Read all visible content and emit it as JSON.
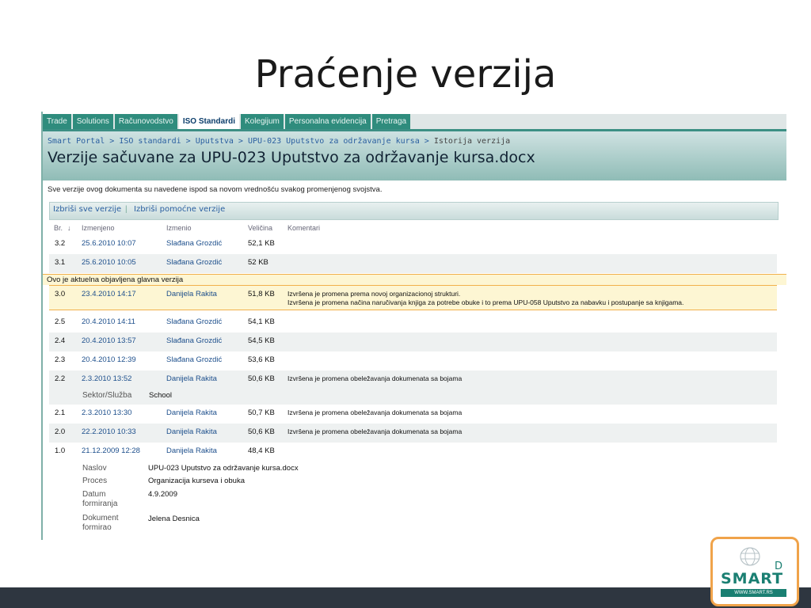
{
  "slide_title": "Praćenje verzija",
  "nav_tabs": [
    {
      "label": "Trade",
      "active": false
    },
    {
      "label": "Solutions",
      "active": false
    },
    {
      "label": "Računovodstvo",
      "active": false
    },
    {
      "label": "ISO Standardi",
      "active": true
    },
    {
      "label": "Kolegijum",
      "active": false
    },
    {
      "label": "Personalna evidencija",
      "active": false
    },
    {
      "label": "Pretraga",
      "active": false
    }
  ],
  "breadcrumb": {
    "items": [
      "Smart Portal",
      "ISO standardi",
      "Uputstva",
      "UPU-023 Uputstvo za održavanje kursa"
    ],
    "current": "Istorija verzija",
    "separator": ">"
  },
  "page_title": "Verzije sačuvane za UPU-023 Uputstvo za održavanje kursa.docx",
  "description": "Sve verzije ovog dokumenta su navedene ispod sa novom vrednošću svakog promenjenog svojstva.",
  "actions": {
    "delete_all": "Izbriši sve verzije",
    "separator": "|",
    "delete_minor": "Izbriši pomoćne verzije"
  },
  "columns": {
    "num": "Br.",
    "sort_icon": "↓",
    "modified": "Izmenjeno",
    "modified_by": "Izmenio",
    "size": "Veličina",
    "comments": "Komentari"
  },
  "current_banner": "Ovo je aktuelna objavljena glavna verzija",
  "versions": [
    {
      "num": "3.2",
      "date": "25.6.2010 10:07",
      "user": "Slađana Grozdić",
      "size": "52,1 KB",
      "comment": ""
    },
    {
      "num": "3.1",
      "date": "25.6.2010 10:05",
      "user": "Slađana Grozdić",
      "size": "52 KB",
      "comment": ""
    },
    {
      "num": "3.0",
      "date": "23.4.2010 14:17",
      "user": "Danijela Rakita",
      "size": "51,8 KB",
      "comment": "Izvršena je promena prema novoj organizacionoj strukturi.",
      "comment2": "Izvršena je promena načina naručivanja knjiga za potrebe obuke i to prema UPU-058 Uputstvo za nabavku i postupanje sa knjigama."
    },
    {
      "num": "2.5",
      "date": "20.4.2010 14:11",
      "user": "Slađana Grozdić",
      "size": "54,1 KB",
      "comment": ""
    },
    {
      "num": "2.4",
      "date": "20.4.2010 13:57",
      "user": "Slađana Grozdić",
      "size": "54,5 KB",
      "comment": ""
    },
    {
      "num": "2.3",
      "date": "20.4.2010 12:39",
      "user": "Slađana Grozdić",
      "size": "53,6 KB",
      "comment": ""
    },
    {
      "num": "2.2",
      "date": "2.3.2010 13:52",
      "user": "Danijela Rakita",
      "size": "50,6 KB",
      "comment": "Izvršena je promena obeležavanja dokumenata sa bojama"
    },
    {
      "num": "2.1",
      "date": "2.3.2010 13:30",
      "user": "Danijela Rakita",
      "size": "50,7 KB",
      "comment": "Izvršena je promena obeležavanja dokumenata sa bojama"
    },
    {
      "num": "2.0",
      "date": "22.2.2010 10:33",
      "user": "Danijela Rakita",
      "size": "50,6 KB",
      "comment": "Izvršena je promena obeležavanja dokumenata sa bojama"
    },
    {
      "num": "1.0",
      "date": "21.12.2009 12:28",
      "user": "Danijela Rakita",
      "size": "48,4 KB",
      "comment": ""
    }
  ],
  "v22_property": {
    "key": "Sektor/Služba",
    "value": "School"
  },
  "v10_properties": [
    {
      "key": "Naslov",
      "value": "UPU-023 Uputstvo za održavanje kursa.docx"
    },
    {
      "key": "Proces",
      "value": "Organizacija kurseva i obuka"
    },
    {
      "key": "Datum formiranja",
      "value": "4.9.2009"
    },
    {
      "key": "Dokument formirao",
      "value": "Jelena Desnica"
    }
  ],
  "logo": {
    "text": "SMART",
    "d": "D",
    "url": "WWW.SMART.RS"
  },
  "colors": {
    "tab_bg": "#2f8c7d",
    "link": "#1d4f8c",
    "current_bg": "#fdf6d3",
    "current_border": "#f1b04c",
    "logo_orange": "#f0a34a",
    "footer": "#2e3640"
  }
}
